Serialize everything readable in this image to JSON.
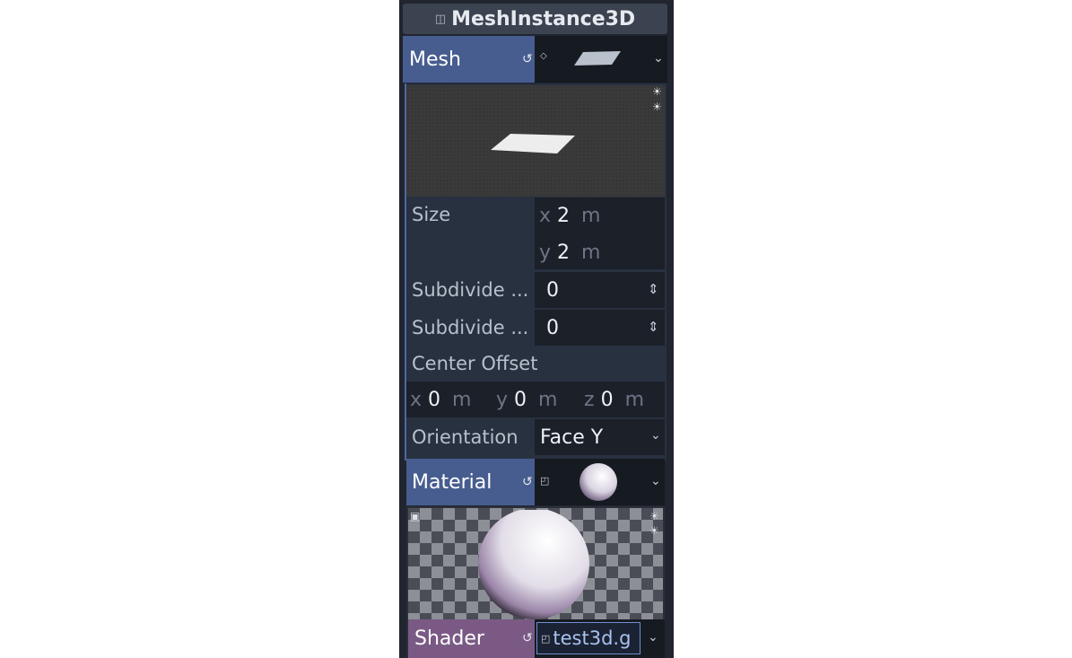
{
  "title": {
    "text": "MeshInstance3D",
    "icon": "mesh-instance-icon"
  },
  "mesh": {
    "label": "Mesh",
    "revert_icon": "revert-icon",
    "dropdown_icon": "chevron-down-icon"
  },
  "plane": {
    "size": {
      "label": "Size",
      "x_axis": "x",
      "x_value": "2",
      "y_axis": "y",
      "y_value": "2",
      "unit": "m"
    },
    "subdivide_width": {
      "label": "Subdivide ...",
      "value": "0"
    },
    "subdivide_depth": {
      "label": "Subdivide ...",
      "value": "0"
    },
    "center_offset": {
      "label": "Center Offset",
      "x_axis": "x",
      "x_value": "0",
      "y_axis": "y",
      "y_value": "0",
      "z_axis": "z",
      "z_value": "0",
      "unit": "m"
    },
    "orientation": {
      "label": "Orientation",
      "value": "Face Y"
    }
  },
  "material": {
    "label": "Material",
    "revert_icon": "revert-icon",
    "dropdown_icon": "chevron-down-icon"
  },
  "shader": {
    "label": "Shader",
    "value": "test3d.g"
  },
  "colors": {
    "panel_bg": "#202530",
    "accent_label": "#475d8f",
    "shader_label": "#7a5a85",
    "field_bg": "#161a21"
  }
}
